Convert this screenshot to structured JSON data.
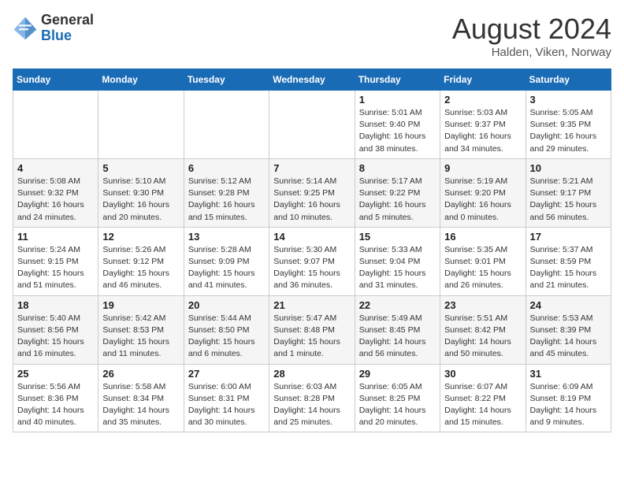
{
  "header": {
    "logo_line1": "General",
    "logo_line2": "Blue",
    "month": "August 2024",
    "location": "Halden, Viken, Norway"
  },
  "weekdays": [
    "Sunday",
    "Monday",
    "Tuesday",
    "Wednesday",
    "Thursday",
    "Friday",
    "Saturday"
  ],
  "weeks": [
    [
      {
        "day": "",
        "info": ""
      },
      {
        "day": "",
        "info": ""
      },
      {
        "day": "",
        "info": ""
      },
      {
        "day": "",
        "info": ""
      },
      {
        "day": "1",
        "info": "Sunrise: 5:01 AM\nSunset: 9:40 PM\nDaylight: 16 hours\nand 38 minutes."
      },
      {
        "day": "2",
        "info": "Sunrise: 5:03 AM\nSunset: 9:37 PM\nDaylight: 16 hours\nand 34 minutes."
      },
      {
        "day": "3",
        "info": "Sunrise: 5:05 AM\nSunset: 9:35 PM\nDaylight: 16 hours\nand 29 minutes."
      }
    ],
    [
      {
        "day": "4",
        "info": "Sunrise: 5:08 AM\nSunset: 9:32 PM\nDaylight: 16 hours\nand 24 minutes."
      },
      {
        "day": "5",
        "info": "Sunrise: 5:10 AM\nSunset: 9:30 PM\nDaylight: 16 hours\nand 20 minutes."
      },
      {
        "day": "6",
        "info": "Sunrise: 5:12 AM\nSunset: 9:28 PM\nDaylight: 16 hours\nand 15 minutes."
      },
      {
        "day": "7",
        "info": "Sunrise: 5:14 AM\nSunset: 9:25 PM\nDaylight: 16 hours\nand 10 minutes."
      },
      {
        "day": "8",
        "info": "Sunrise: 5:17 AM\nSunset: 9:22 PM\nDaylight: 16 hours\nand 5 minutes."
      },
      {
        "day": "9",
        "info": "Sunrise: 5:19 AM\nSunset: 9:20 PM\nDaylight: 16 hours\nand 0 minutes."
      },
      {
        "day": "10",
        "info": "Sunrise: 5:21 AM\nSunset: 9:17 PM\nDaylight: 15 hours\nand 56 minutes."
      }
    ],
    [
      {
        "day": "11",
        "info": "Sunrise: 5:24 AM\nSunset: 9:15 PM\nDaylight: 15 hours\nand 51 minutes."
      },
      {
        "day": "12",
        "info": "Sunrise: 5:26 AM\nSunset: 9:12 PM\nDaylight: 15 hours\nand 46 minutes."
      },
      {
        "day": "13",
        "info": "Sunrise: 5:28 AM\nSunset: 9:09 PM\nDaylight: 15 hours\nand 41 minutes."
      },
      {
        "day": "14",
        "info": "Sunrise: 5:30 AM\nSunset: 9:07 PM\nDaylight: 15 hours\nand 36 minutes."
      },
      {
        "day": "15",
        "info": "Sunrise: 5:33 AM\nSunset: 9:04 PM\nDaylight: 15 hours\nand 31 minutes."
      },
      {
        "day": "16",
        "info": "Sunrise: 5:35 AM\nSunset: 9:01 PM\nDaylight: 15 hours\nand 26 minutes."
      },
      {
        "day": "17",
        "info": "Sunrise: 5:37 AM\nSunset: 8:59 PM\nDaylight: 15 hours\nand 21 minutes."
      }
    ],
    [
      {
        "day": "18",
        "info": "Sunrise: 5:40 AM\nSunset: 8:56 PM\nDaylight: 15 hours\nand 16 minutes."
      },
      {
        "day": "19",
        "info": "Sunrise: 5:42 AM\nSunset: 8:53 PM\nDaylight: 15 hours\nand 11 minutes."
      },
      {
        "day": "20",
        "info": "Sunrise: 5:44 AM\nSunset: 8:50 PM\nDaylight: 15 hours\nand 6 minutes."
      },
      {
        "day": "21",
        "info": "Sunrise: 5:47 AM\nSunset: 8:48 PM\nDaylight: 15 hours\nand 1 minute."
      },
      {
        "day": "22",
        "info": "Sunrise: 5:49 AM\nSunset: 8:45 PM\nDaylight: 14 hours\nand 56 minutes."
      },
      {
        "day": "23",
        "info": "Sunrise: 5:51 AM\nSunset: 8:42 PM\nDaylight: 14 hours\nand 50 minutes."
      },
      {
        "day": "24",
        "info": "Sunrise: 5:53 AM\nSunset: 8:39 PM\nDaylight: 14 hours\nand 45 minutes."
      }
    ],
    [
      {
        "day": "25",
        "info": "Sunrise: 5:56 AM\nSunset: 8:36 PM\nDaylight: 14 hours\nand 40 minutes."
      },
      {
        "day": "26",
        "info": "Sunrise: 5:58 AM\nSunset: 8:34 PM\nDaylight: 14 hours\nand 35 minutes."
      },
      {
        "day": "27",
        "info": "Sunrise: 6:00 AM\nSunset: 8:31 PM\nDaylight: 14 hours\nand 30 minutes."
      },
      {
        "day": "28",
        "info": "Sunrise: 6:03 AM\nSunset: 8:28 PM\nDaylight: 14 hours\nand 25 minutes."
      },
      {
        "day": "29",
        "info": "Sunrise: 6:05 AM\nSunset: 8:25 PM\nDaylight: 14 hours\nand 20 minutes."
      },
      {
        "day": "30",
        "info": "Sunrise: 6:07 AM\nSunset: 8:22 PM\nDaylight: 14 hours\nand 15 minutes."
      },
      {
        "day": "31",
        "info": "Sunrise: 6:09 AM\nSunset: 8:19 PM\nDaylight: 14 hours\nand 9 minutes."
      }
    ]
  ]
}
